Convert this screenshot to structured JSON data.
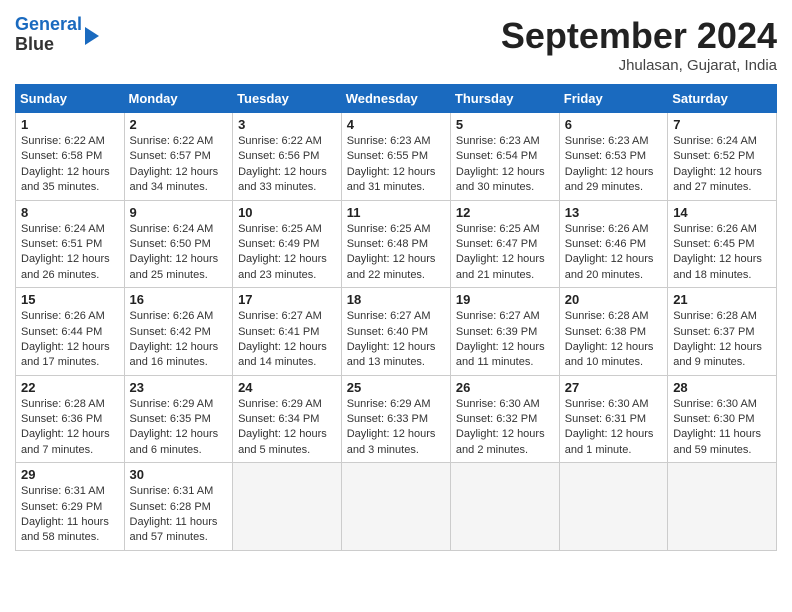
{
  "logo": {
    "line1": "General",
    "line2": "Blue"
  },
  "title": "September 2024",
  "location": "Jhulasan, Gujarat, India",
  "weekdays": [
    "Sunday",
    "Monday",
    "Tuesday",
    "Wednesday",
    "Thursday",
    "Friday",
    "Saturday"
  ],
  "weeks": [
    [
      {
        "day": 1,
        "info": "Sunrise: 6:22 AM\nSunset: 6:58 PM\nDaylight: 12 hours\nand 35 minutes."
      },
      {
        "day": 2,
        "info": "Sunrise: 6:22 AM\nSunset: 6:57 PM\nDaylight: 12 hours\nand 34 minutes."
      },
      {
        "day": 3,
        "info": "Sunrise: 6:22 AM\nSunset: 6:56 PM\nDaylight: 12 hours\nand 33 minutes."
      },
      {
        "day": 4,
        "info": "Sunrise: 6:23 AM\nSunset: 6:55 PM\nDaylight: 12 hours\nand 31 minutes."
      },
      {
        "day": 5,
        "info": "Sunrise: 6:23 AM\nSunset: 6:54 PM\nDaylight: 12 hours\nand 30 minutes."
      },
      {
        "day": 6,
        "info": "Sunrise: 6:23 AM\nSunset: 6:53 PM\nDaylight: 12 hours\nand 29 minutes."
      },
      {
        "day": 7,
        "info": "Sunrise: 6:24 AM\nSunset: 6:52 PM\nDaylight: 12 hours\nand 27 minutes."
      }
    ],
    [
      {
        "day": 8,
        "info": "Sunrise: 6:24 AM\nSunset: 6:51 PM\nDaylight: 12 hours\nand 26 minutes."
      },
      {
        "day": 9,
        "info": "Sunrise: 6:24 AM\nSunset: 6:50 PM\nDaylight: 12 hours\nand 25 minutes."
      },
      {
        "day": 10,
        "info": "Sunrise: 6:25 AM\nSunset: 6:49 PM\nDaylight: 12 hours\nand 23 minutes."
      },
      {
        "day": 11,
        "info": "Sunrise: 6:25 AM\nSunset: 6:48 PM\nDaylight: 12 hours\nand 22 minutes."
      },
      {
        "day": 12,
        "info": "Sunrise: 6:25 AM\nSunset: 6:47 PM\nDaylight: 12 hours\nand 21 minutes."
      },
      {
        "day": 13,
        "info": "Sunrise: 6:26 AM\nSunset: 6:46 PM\nDaylight: 12 hours\nand 20 minutes."
      },
      {
        "day": 14,
        "info": "Sunrise: 6:26 AM\nSunset: 6:45 PM\nDaylight: 12 hours\nand 18 minutes."
      }
    ],
    [
      {
        "day": 15,
        "info": "Sunrise: 6:26 AM\nSunset: 6:44 PM\nDaylight: 12 hours\nand 17 minutes."
      },
      {
        "day": 16,
        "info": "Sunrise: 6:26 AM\nSunset: 6:42 PM\nDaylight: 12 hours\nand 16 minutes."
      },
      {
        "day": 17,
        "info": "Sunrise: 6:27 AM\nSunset: 6:41 PM\nDaylight: 12 hours\nand 14 minutes."
      },
      {
        "day": 18,
        "info": "Sunrise: 6:27 AM\nSunset: 6:40 PM\nDaylight: 12 hours\nand 13 minutes."
      },
      {
        "day": 19,
        "info": "Sunrise: 6:27 AM\nSunset: 6:39 PM\nDaylight: 12 hours\nand 11 minutes."
      },
      {
        "day": 20,
        "info": "Sunrise: 6:28 AM\nSunset: 6:38 PM\nDaylight: 12 hours\nand 10 minutes."
      },
      {
        "day": 21,
        "info": "Sunrise: 6:28 AM\nSunset: 6:37 PM\nDaylight: 12 hours\nand 9 minutes."
      }
    ],
    [
      {
        "day": 22,
        "info": "Sunrise: 6:28 AM\nSunset: 6:36 PM\nDaylight: 12 hours\nand 7 minutes."
      },
      {
        "day": 23,
        "info": "Sunrise: 6:29 AM\nSunset: 6:35 PM\nDaylight: 12 hours\nand 6 minutes."
      },
      {
        "day": 24,
        "info": "Sunrise: 6:29 AM\nSunset: 6:34 PM\nDaylight: 12 hours\nand 5 minutes."
      },
      {
        "day": 25,
        "info": "Sunrise: 6:29 AM\nSunset: 6:33 PM\nDaylight: 12 hours\nand 3 minutes."
      },
      {
        "day": 26,
        "info": "Sunrise: 6:30 AM\nSunset: 6:32 PM\nDaylight: 12 hours\nand 2 minutes."
      },
      {
        "day": 27,
        "info": "Sunrise: 6:30 AM\nSunset: 6:31 PM\nDaylight: 12 hours\nand 1 minute."
      },
      {
        "day": 28,
        "info": "Sunrise: 6:30 AM\nSunset: 6:30 PM\nDaylight: 11 hours\nand 59 minutes."
      }
    ],
    [
      {
        "day": 29,
        "info": "Sunrise: 6:31 AM\nSunset: 6:29 PM\nDaylight: 11 hours\nand 58 minutes."
      },
      {
        "day": 30,
        "info": "Sunrise: 6:31 AM\nSunset: 6:28 PM\nDaylight: 11 hours\nand 57 minutes."
      },
      null,
      null,
      null,
      null,
      null
    ]
  ]
}
